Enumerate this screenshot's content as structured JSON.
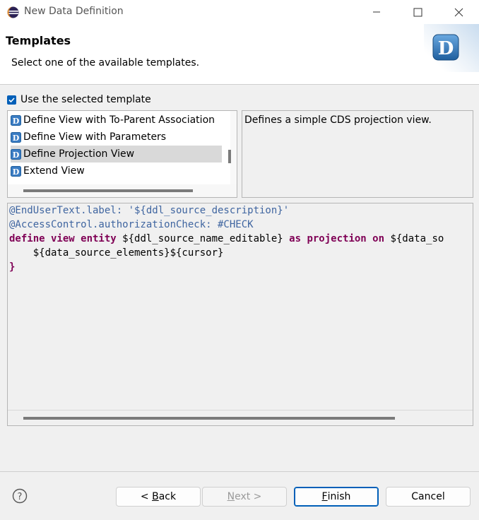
{
  "window": {
    "title": "New Data Definition",
    "controls": [
      "minimize",
      "maximize",
      "close"
    ]
  },
  "header": {
    "title": "Templates",
    "description": "Select one of the available templates.",
    "logo_letter": "D"
  },
  "use_template": {
    "label": "Use the selected template",
    "checked": true
  },
  "templates": {
    "items": [
      {
        "label": "Define View with To-Parent Association"
      },
      {
        "label": "Define View with Parameters"
      },
      {
        "label": "Define Projection View"
      },
      {
        "label": "Extend View"
      }
    ],
    "selected": "Define Projection View"
  },
  "template_description": "Defines a simple CDS projection view.",
  "code": {
    "line1": "@EndUserText.label: '${ddl_source_description}'",
    "line2": "@AccessControl.authorizationCheck: #CHECK",
    "line3_kw1": "define view entity ",
    "line3_var1": "${ddl_source_name_editable}",
    "line3_kw2": " as projection on ",
    "line3_var2": "${data_so",
    "line4": "    ${data_source_elements}${cursor}",
    "line5": "}"
  },
  "buttons": {
    "back": {
      "prefix": "< ",
      "mnemonic": "B",
      "rest": "ack"
    },
    "next": {
      "mnemonic": "N",
      "rest": "ext >"
    },
    "finish": {
      "mnemonic": "F",
      "rest": "inish"
    },
    "cancel": "Cancel"
  },
  "colors": {
    "accent": "#005fb8",
    "keyword": "#7f0055",
    "annotation": "#3f65a0"
  }
}
